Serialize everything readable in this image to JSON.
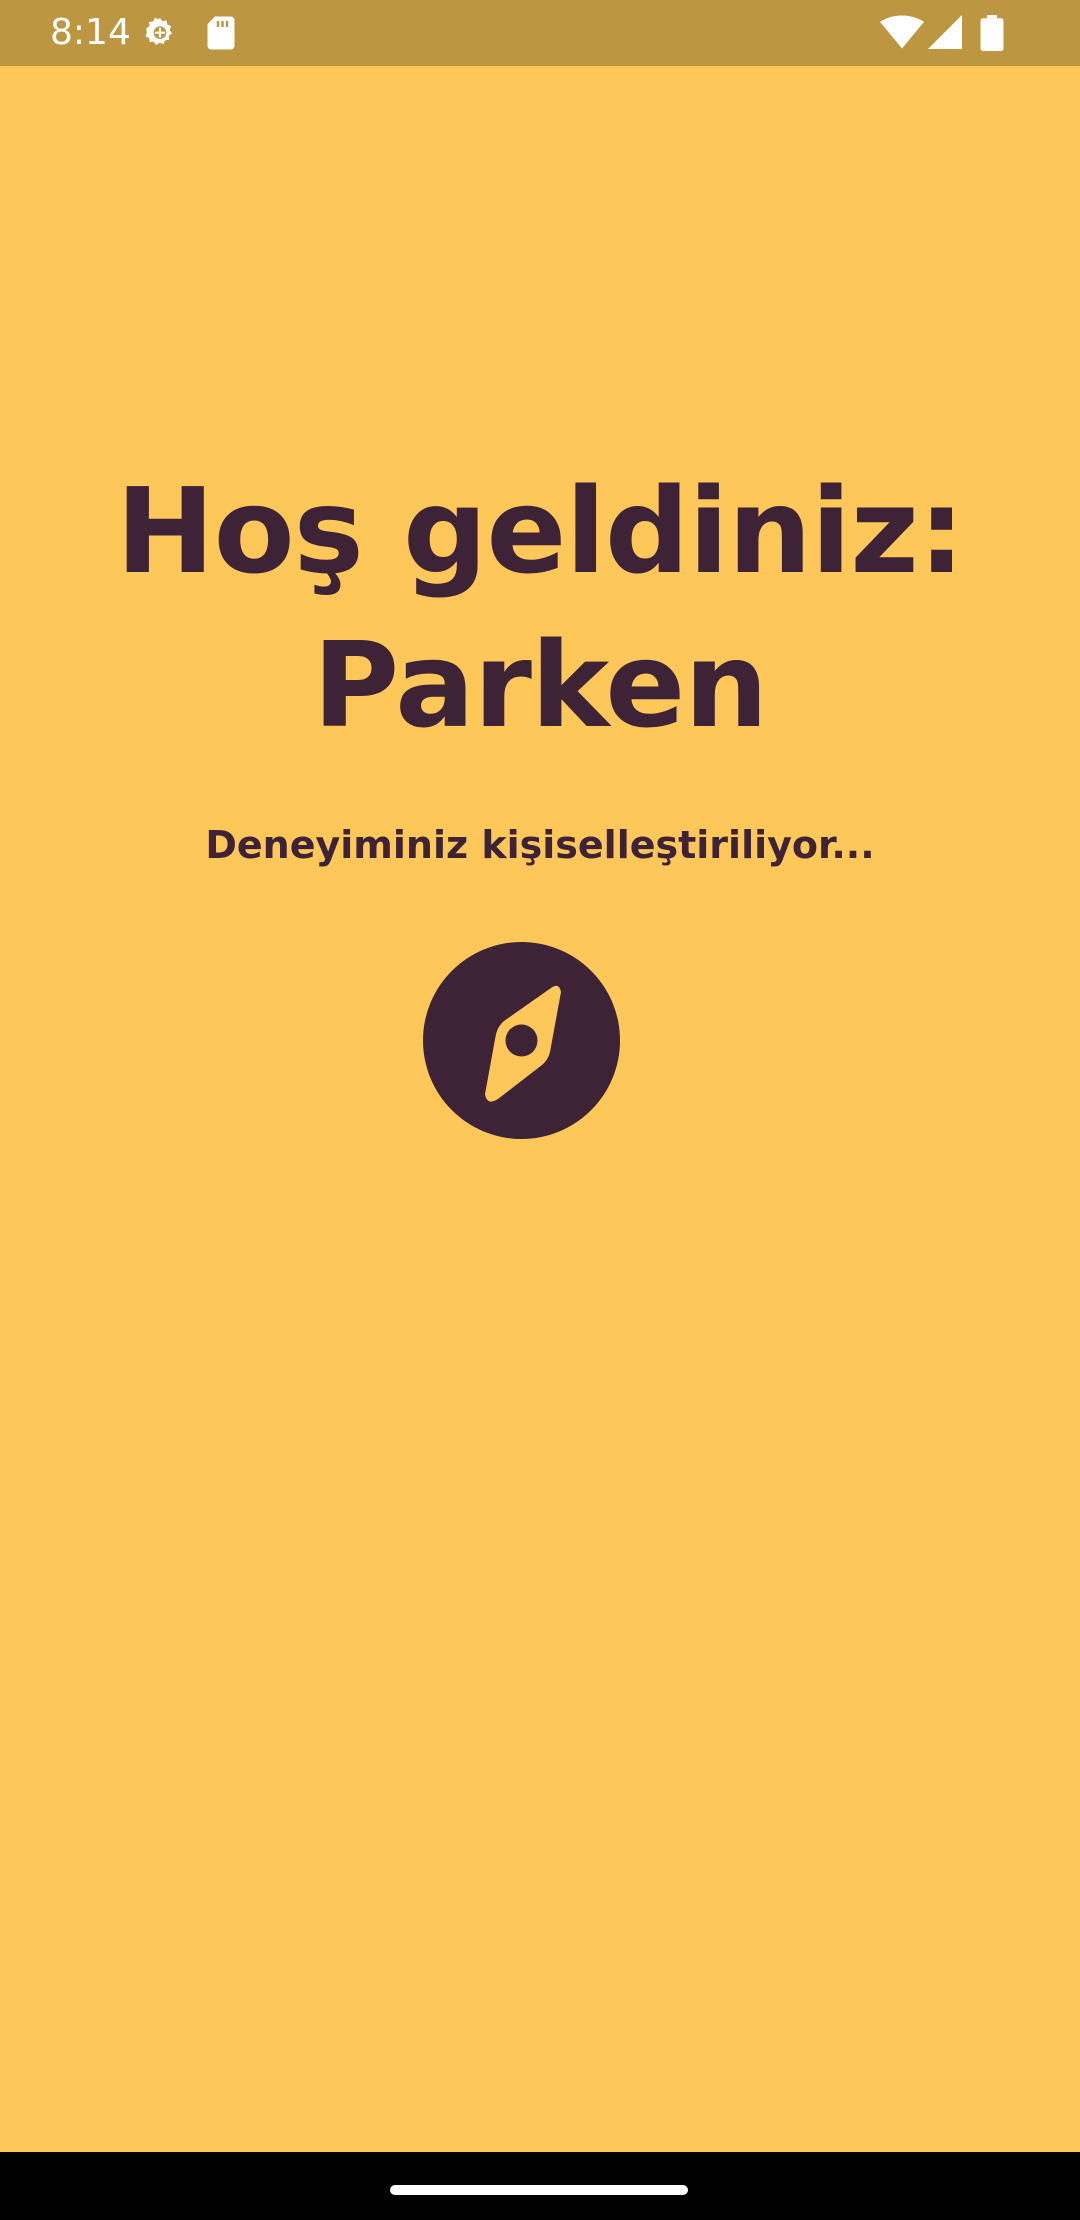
{
  "status_bar": {
    "time": "8:14",
    "icons": [
      "settings-gear-icon",
      "sd-card-icon",
      "wifi-icon",
      "cell-signal-icon",
      "battery-icon"
    ]
  },
  "welcome": {
    "title_line1": "Hoş geldiniz:",
    "title_line2": "Parken",
    "subtitle": "Deneyiminiz kişiselleştiriliyor..."
  },
  "loading_icon": "compass-icon",
  "colors": {
    "background": "#FEC75A",
    "status_bar": "#BD9641",
    "text": "#3E2236",
    "nav_bar": "#000000"
  }
}
